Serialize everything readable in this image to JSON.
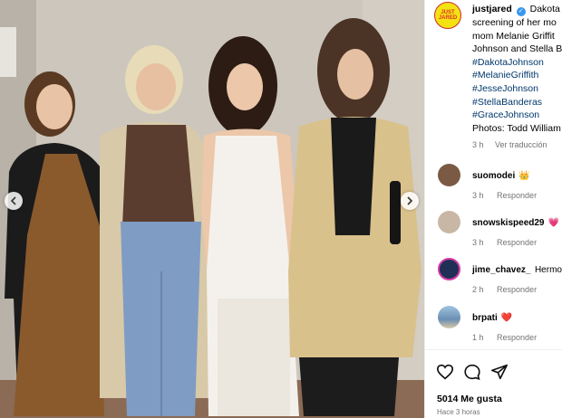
{
  "post": {
    "alt": "Four women posing together at a screening event",
    "carousel": {
      "prev_icon": "chevron-left-icon",
      "next_icon": "chevron-right-icon"
    }
  },
  "caption": {
    "avatar_text": "JUST JARED",
    "username": "justjared",
    "verified_icon": "verified-badge-icon",
    "line1_rest": "Dakota J",
    "line2": "screening of her mo",
    "line3": "mom Melanie Griffit",
    "line4": "Johnson and Stella B",
    "hashtags": [
      "#DakotaJohnson",
      "#MelanieGriffith",
      "#JesseJohnson",
      "#StellaBanderas",
      "#GraceJohnson"
    ],
    "photos_credit": "Photos: Todd William",
    "time": "3 h",
    "translate": "Ver traducción"
  },
  "comments": [
    {
      "user": "suomodei",
      "emoji": "👑",
      "time": "3 h",
      "reply": "Responder",
      "avatar_color": "#7a5a44"
    },
    {
      "user": "snowskispeed29",
      "emoji": "💗",
      "time": "3 h",
      "reply": "Responder",
      "avatar_color": "#c9b7a6"
    },
    {
      "user": "jime_chavez_",
      "text": "Hermo",
      "time": "2 h",
      "reply": "Responder",
      "avatar_color": "#1f2f55"
    },
    {
      "user": "brpati",
      "emoji": "❤️",
      "time": "1 h",
      "reply": "Responder",
      "avatar_color": "#6b8fb3"
    }
  ],
  "actions": {
    "like_icon": "heart-icon",
    "comment_icon": "comment-icon",
    "share_icon": "share-icon"
  },
  "likes": "5014 Me gusta",
  "posted_ago": "Hace 3 horas",
  "colors": {
    "hashtag": "#00376b",
    "meta": "#737373",
    "verified": "#3897f0"
  }
}
